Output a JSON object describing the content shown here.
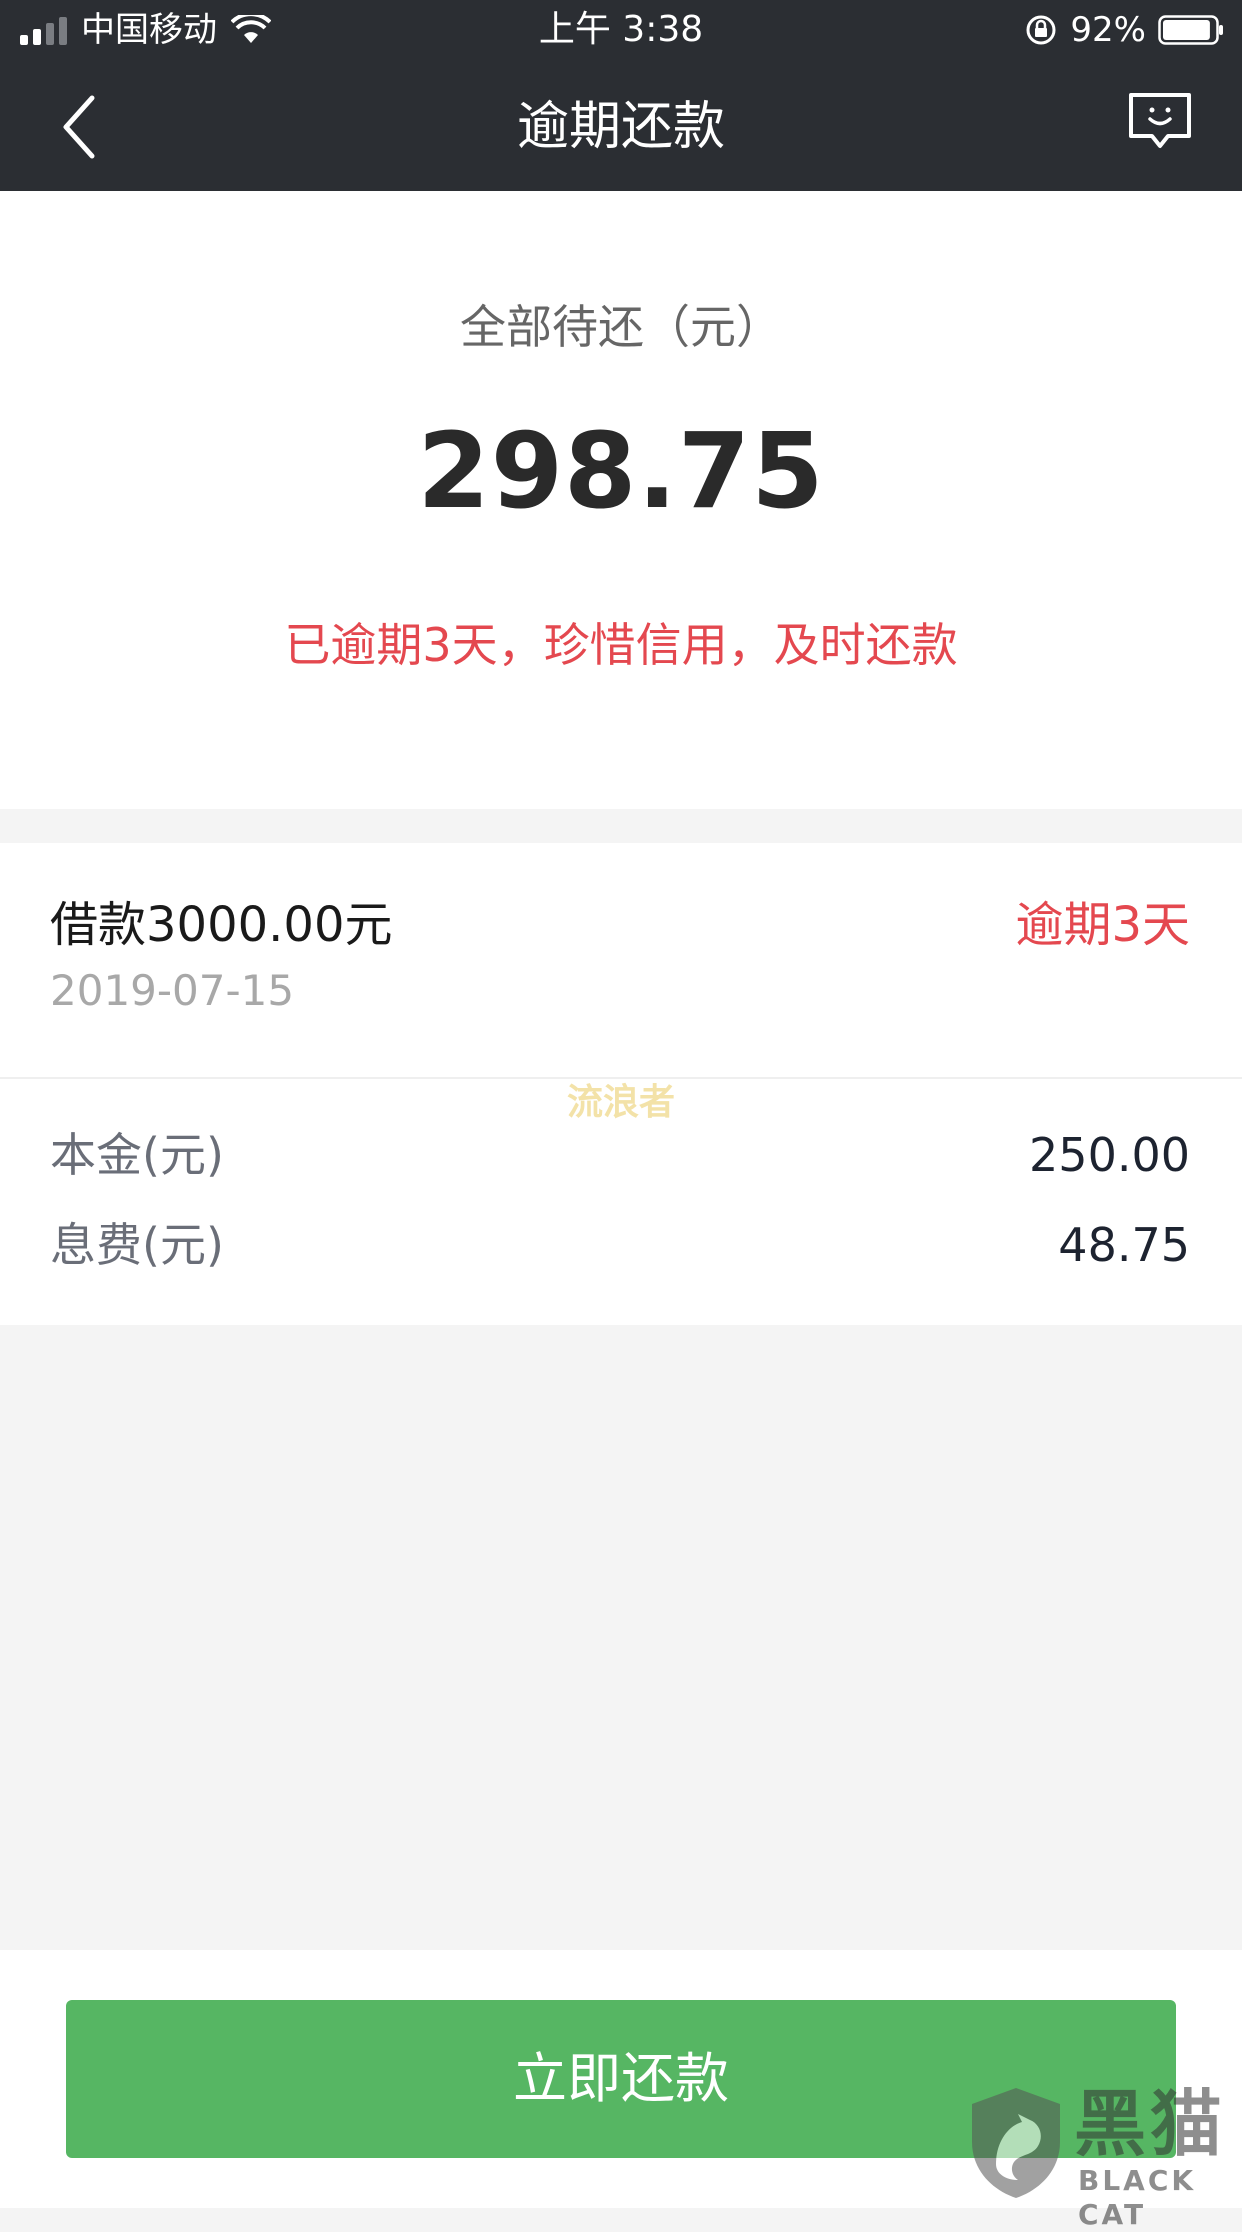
{
  "status_bar": {
    "carrier": "中国移动",
    "time": "上午 3:38",
    "battery_percent": "92%",
    "battery_level": 0.92,
    "signal_bars": 2
  },
  "nav": {
    "title": "逾期还款",
    "back_icon": "chevron-left-icon",
    "feedback_icon": "feedback-chat-icon"
  },
  "summary": {
    "label": "全部待还（元）",
    "amount": "298.75",
    "warning": "已逾期3天，珍惜信用，及时还款"
  },
  "loan": {
    "title": "借款3000.00元",
    "date": "2019-07-15",
    "status": "逾期3天",
    "watermark": "流浪者",
    "rows": [
      {
        "label": "本金(元)",
        "value": "250.00"
      },
      {
        "label": "息费(元)",
        "value": "48.75"
      }
    ]
  },
  "action": {
    "pay_button": "立即还款"
  },
  "logo": {
    "cn": "黑猫",
    "en": "BLACK CAT"
  },
  "colors": {
    "header_bg": "#2b2e33",
    "warning_red": "#e4484f",
    "button_green": "#56b663"
  }
}
